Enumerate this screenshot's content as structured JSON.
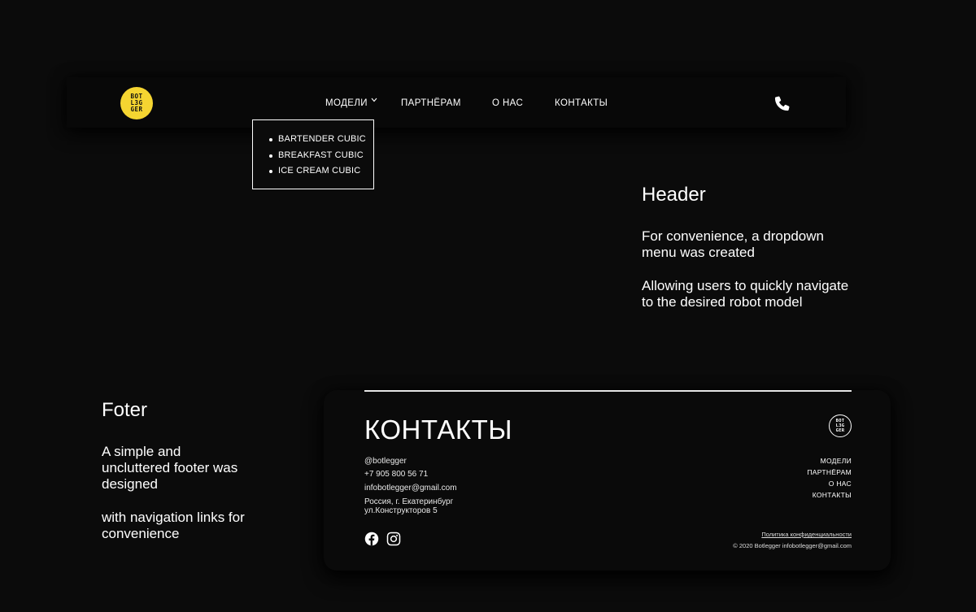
{
  "header": {
    "logo_text_lines": [
      "BOT",
      "L3G",
      "GER"
    ],
    "nav": {
      "models": "МОДЕЛИ",
      "partners": "ПАРТНЁРАМ",
      "about": "О НАС",
      "contacts": "КОНТАКТЫ"
    },
    "dropdown": [
      "BARTENDER CUBIC",
      "BREAKFAST CUBIC",
      "ICE CREAM CUBIC"
    ],
    "icons": {
      "chevron": "chevron-down-icon",
      "phone": "phone-icon"
    }
  },
  "annotations": {
    "header": {
      "title": "Header",
      "p1": "For convenience, a dropdown\nmenu was created",
      "p2": "Allowing users to quickly navigate\nto the desired robot model"
    },
    "footer": {
      "title": "Foter",
      "p1": "A simple and\nuncluttered footer was\ndesigned",
      "p2": "with navigation links for\nconvenience"
    }
  },
  "footer": {
    "heading": "КОНТАКТЫ",
    "handle": "@botlegger",
    "phone": "+7 905 800 56 71",
    "email": "infobotlegger@gmail.com",
    "address_line1": "Россия, г. Екатеринбург",
    "address_line2": "ул.Конструкторов 5",
    "nav": [
      "МОДЕЛИ",
      "ПАРТНЁРАМ",
      "О НАС",
      "КОНТАКТЫ"
    ],
    "privacy": "Политика конфиденциальности",
    "copyright": "© 2020 Botlegger infobotlegger@gmail.com",
    "icons": {
      "facebook": "facebook-icon",
      "instagram": "instagram-icon"
    }
  },
  "colors": {
    "background": "#0b0b0b",
    "logo_yellow": "#f5d531",
    "text": "#ffffff"
  }
}
